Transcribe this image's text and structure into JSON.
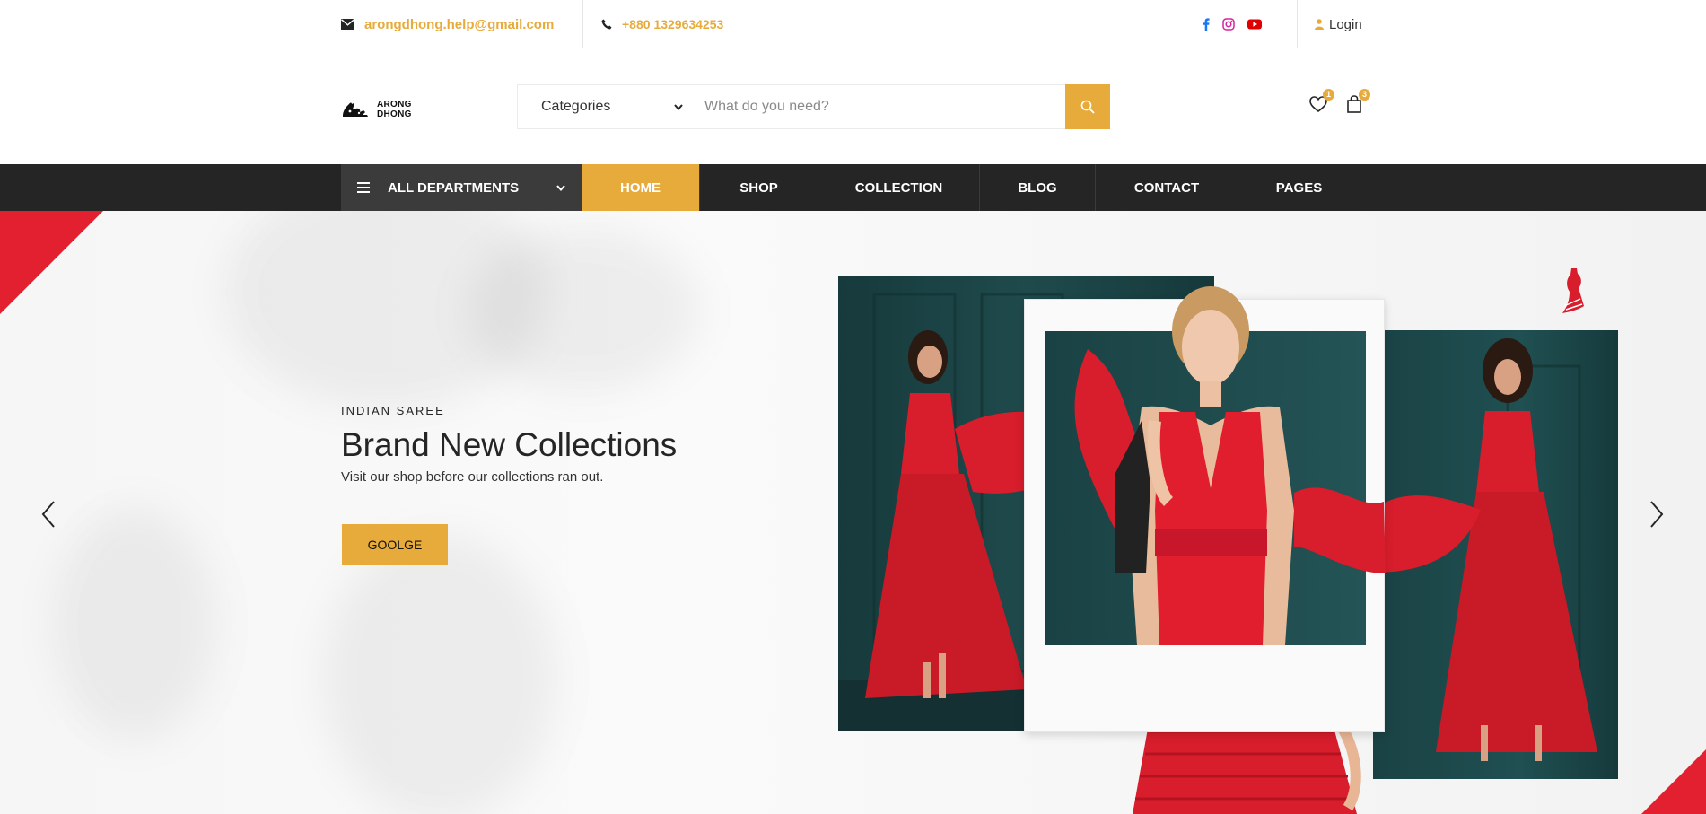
{
  "topbar": {
    "email": "arongdhong.help@gmail.com",
    "phone": "+880 1329634253",
    "social_icons": [
      "facebook-icon",
      "instagram-icon",
      "youtube-icon"
    ],
    "login_label": "Login"
  },
  "header": {
    "logo_text_line1": "ARONG",
    "logo_text_line2": "DHONG",
    "categories_label": "Categories",
    "search_placeholder": "What do you need?",
    "wishlist_count": "1",
    "cart_count": "3"
  },
  "nav": {
    "departments_label": "ALL DEPARTMENTS",
    "items": [
      {
        "label": "HOME",
        "active": true
      },
      {
        "label": "SHOP",
        "active": false
      },
      {
        "label": "COLLECTION",
        "active": false
      },
      {
        "label": "BLOG",
        "active": false
      },
      {
        "label": "CONTACT",
        "active": false
      },
      {
        "label": "PAGES",
        "active": false
      }
    ]
  },
  "hero": {
    "kicker": "INDIAN SAREE",
    "title": "Brand New Collections",
    "subtitle": "Visit our shop before our collections ran out.",
    "button_label": "GOOLGE"
  },
  "colors": {
    "accent": "#e7ab3c",
    "nav_bg": "#252525",
    "dept_bg": "#3b3b3b",
    "brand_red": "#e3202f",
    "dress_red": "#d81d2c"
  }
}
